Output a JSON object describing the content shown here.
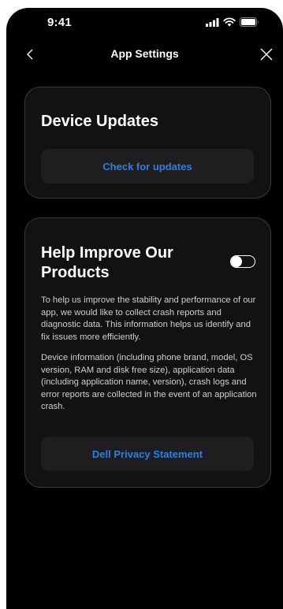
{
  "status_bar": {
    "time": "9:41",
    "icons": [
      "cellular-signal-icon",
      "wifi-icon",
      "battery-icon"
    ]
  },
  "nav": {
    "title": "App Settings",
    "back_icon": "chevron-left-icon",
    "close_icon": "close-icon"
  },
  "device_updates": {
    "title": "Device Updates",
    "button_label": "Check for updates"
  },
  "help_improve": {
    "title": "Help Improve Our Products",
    "toggle_on": false,
    "paragraph_1": "To help us improve the stability and performance of our app, we would like to collect crash reports and diagnostic data. This information helps us identify and fix issues more efficiently.",
    "paragraph_2": "Device information (including phone brand, model, OS version, RAM and disk free size), application data (including application name, version), crash logs and error reports are collected in the event of an application crash.",
    "button_label": "Dell Privacy Statement"
  },
  "colors": {
    "background": "#000000",
    "card": "#121214",
    "card_border": "#3a3a3d",
    "button": "#1e1e21",
    "accent": "#2f7fe0"
  }
}
